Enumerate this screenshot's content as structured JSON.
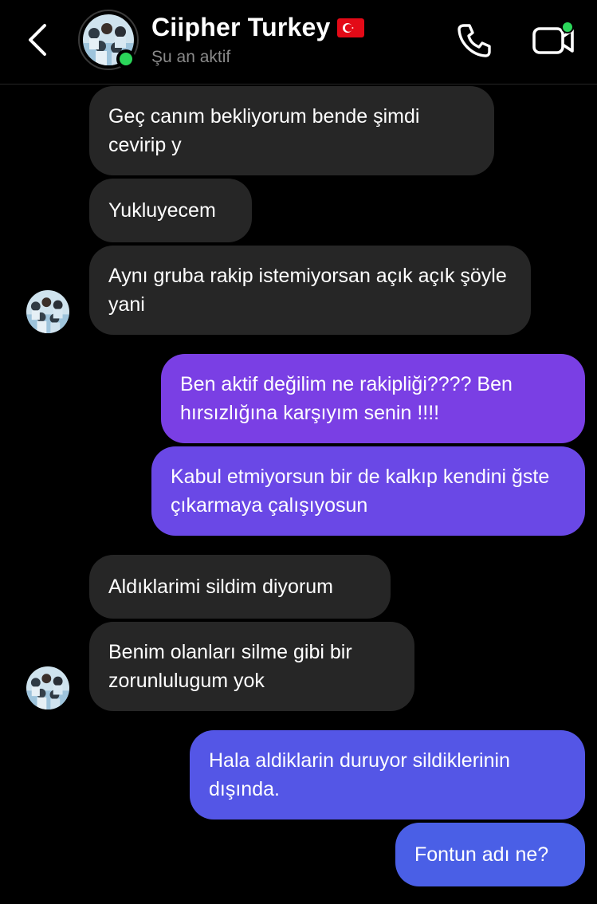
{
  "header": {
    "contact_name": "Ciipher Turkey",
    "status": "Şu an aktif",
    "icons": [
      "back-chevron-icon",
      "phone-icon",
      "video-camera-icon",
      "turkey-flag-icon"
    ],
    "online_color": "#2bd65a"
  },
  "messages": [
    {
      "side": "in",
      "text": "Geç canım bekliyorum bende şimdi cevirip y"
    },
    {
      "side": "in",
      "text": "Yukluyecem"
    },
    {
      "side": "in",
      "text": "Aynı gruba rakip istemiyorsan açık açık şöyle yani"
    },
    {
      "side": "out",
      "text": "Ben aktif değilim ne rakipliği???? Ben hırsızlığına karşıyım senin !!!!"
    },
    {
      "side": "out",
      "text": "Kabul etmiyorsun bir de kalkıp kendini ğste çıkarmaya çalışıyosun"
    },
    {
      "side": "in",
      "text": "Aldıklarimi sildim diyorum"
    },
    {
      "side": "in",
      "text": "Benim olanları silme gibi bir zorunlulugum yok"
    },
    {
      "side": "out",
      "text": "Hala aldiklarin duruyor sildiklerinin dışında."
    },
    {
      "side": "out",
      "text": "Fontun adı ne?"
    }
  ],
  "colors": {
    "incoming_bubble": "#262626",
    "outgoing_top": "#7a3fe4",
    "outgoing_bottom": "#4a5fe6"
  }
}
